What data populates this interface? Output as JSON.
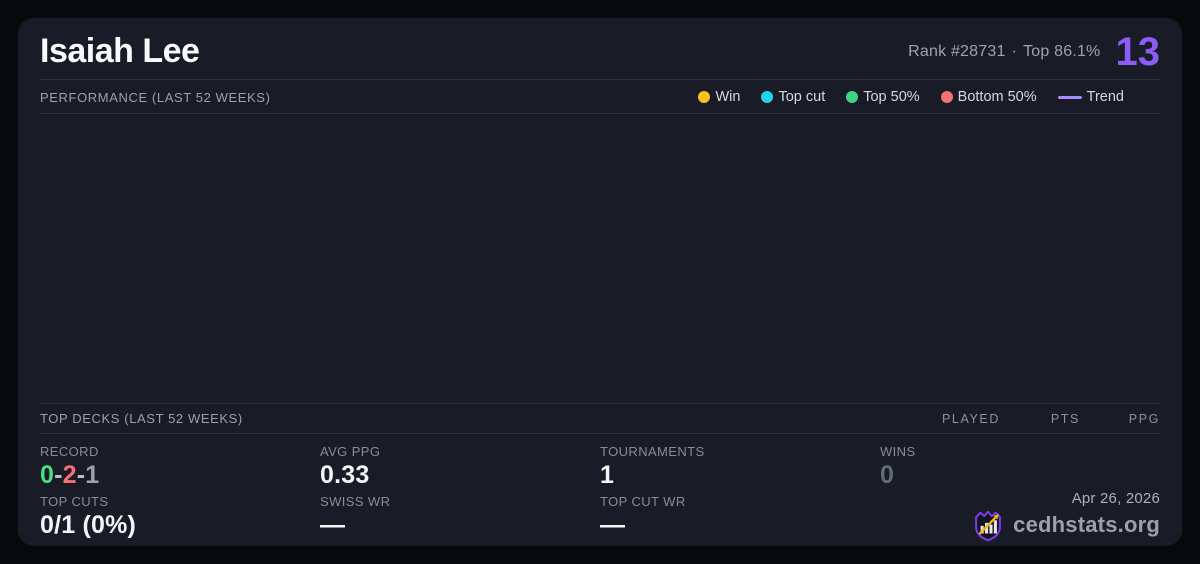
{
  "colors": {
    "accent": "#8b5cf6",
    "win": "#f2c21d",
    "top_cut": "#22d3ee",
    "top50": "#3fd483",
    "bottom50": "#f87171",
    "trend": "#a78bfa",
    "record_win": "#4ade80",
    "record_loss": "#f87171"
  },
  "header": {
    "title": "Isaiah Lee",
    "rank": "Rank #28731",
    "separator": "·",
    "top_percent": "Top 86.1%",
    "score": "13"
  },
  "performance": {
    "title": "PERFORMANCE (LAST 52 WEEKS)",
    "legend": [
      {
        "label": "Win"
      },
      {
        "label": "Top cut"
      },
      {
        "label": "Top 50%"
      },
      {
        "label": "Bottom 50%"
      },
      {
        "label": "Trend"
      }
    ]
  },
  "top_decks": {
    "title": "TOP DECKS (LAST 52 WEEKS)",
    "columns": [
      "PLAYED",
      "PTS",
      "PPG"
    ],
    "rows": []
  },
  "stats": {
    "record": {
      "label": "RECORD",
      "wins": "0",
      "sep1": "-",
      "losses": "2",
      "sep2": "-",
      "draws": "1"
    },
    "avg_ppg": {
      "label": "AVG PPG",
      "value": "0.33"
    },
    "tournaments": {
      "label": "TOURNAMENTS",
      "value": "1"
    },
    "wins": {
      "label": "WINS",
      "value": "0"
    },
    "top_cuts": {
      "label": "TOP CUTS",
      "value": "0/1 (0%)"
    },
    "swiss_wr": {
      "label": "SWISS WR",
      "value": "—"
    },
    "top_cut_wr": {
      "label": "TOP CUT WR",
      "value": "—"
    }
  },
  "footer": {
    "date": "Apr 26, 2026",
    "brand": "cedhstats.org"
  }
}
